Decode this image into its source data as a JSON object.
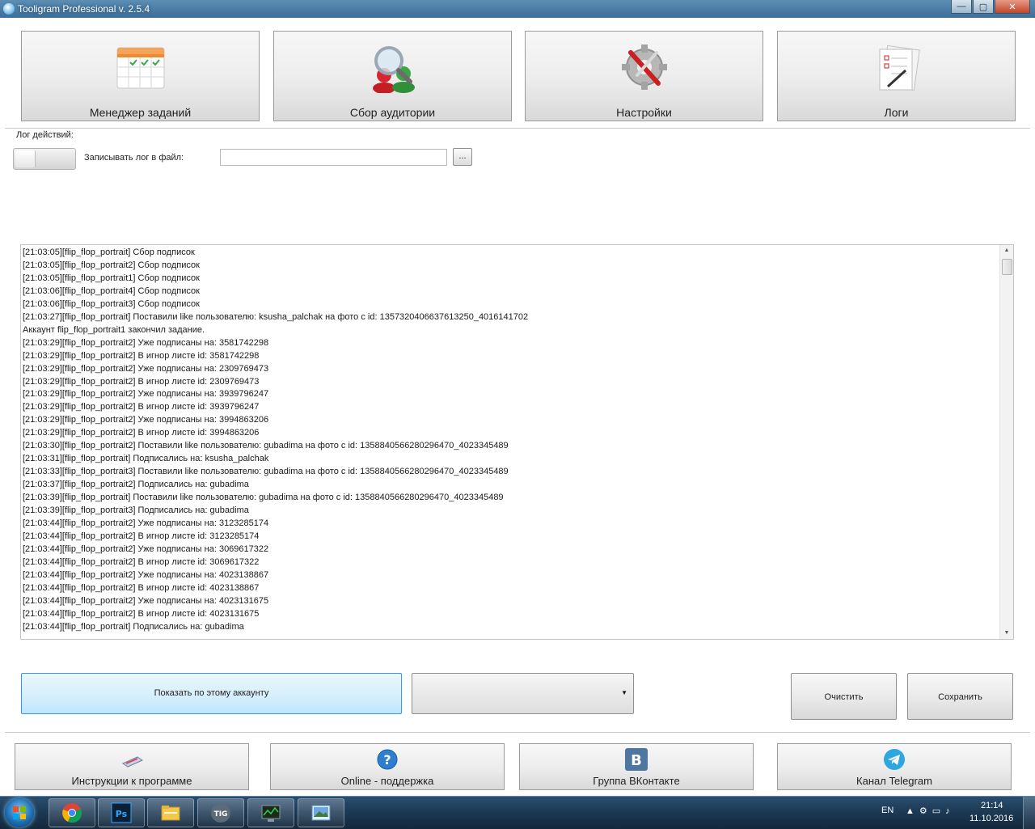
{
  "window": {
    "title": "Tooligram Professional v. 2.5.4",
    "buttons": {
      "minimize": "—",
      "maximize": "▢",
      "close": "✕"
    }
  },
  "top_nav": [
    {
      "label": "Менеджер заданий",
      "icon": "calendar-tasks-icon"
    },
    {
      "label": "Сбор аудитории",
      "icon": "audience-search-icon"
    },
    {
      "label": "Настройки",
      "icon": "settings-gear-icon"
    },
    {
      "label": "Логи",
      "icon": "log-pages-icon"
    }
  ],
  "log_panel": {
    "group_title": "Лог действий:",
    "write_to_file_label": "Записывать лог в файл:",
    "file_path_value": "",
    "browse_label": "...",
    "toggle_on": false,
    "lines": [
      "[21:03:05][flip_flop_portrait] Сбор подписок",
      "[21:03:05][flip_flop_portrait2] Сбор подписок",
      "[21:03:05][flip_flop_portrait1] Сбор подписок",
      "[21:03:06][flip_flop_portrait4] Сбор подписок",
      "[21:03:06][flip_flop_portrait3] Сбор подписок",
      "[21:03:27][flip_flop_portrait] Поставили like пользователю: ksusha_palchak на фото с id: 1357320406637613250_4016141702",
      "Аккаунт flip_flop_portrait1 закончил задание.",
      "[21:03:29][flip_flop_portrait2] Уже подписаны на: 3581742298",
      "[21:03:29][flip_flop_portrait2] В игнор листе id: 3581742298",
      "[21:03:29][flip_flop_portrait2] Уже подписаны на: 2309769473",
      "[21:03:29][flip_flop_portrait2] В игнор листе id: 2309769473",
      "[21:03:29][flip_flop_portrait2] Уже подписаны на: 3939796247",
      "[21:03:29][flip_flop_portrait2] В игнор листе id: 3939796247",
      "[21:03:29][flip_flop_portrait2] Уже подписаны на: 3994863206",
      "[21:03:29][flip_flop_portrait2] В игнор листе id: 3994863206",
      "[21:03:30][flip_flop_portrait2] Поставили like пользователю: gubadima на фото с id: 1358840566280296470_4023345489",
      "[21:03:31][flip_flop_portrait] Подписались на: ksusha_palchak",
      "[21:03:33][flip_flop_portrait3] Поставили like пользователю: gubadima на фото с id: 1358840566280296470_4023345489",
      "[21:03:37][flip_flop_portrait2] Подписались на: gubadima",
      "[21:03:39][flip_flop_portrait] Поставили like пользователю: gubadima на фото с id: 1358840566280296470_4023345489",
      "[21:03:39][flip_flop_portrait3] Подписались на: gubadima",
      "[21:03:44][flip_flop_portrait2] Уже подписаны на: 3123285174",
      "[21:03:44][flip_flop_portrait2] В игнор листе id: 3123285174",
      "[21:03:44][flip_flop_portrait2] Уже подписаны на: 3069617322",
      "[21:03:44][flip_flop_portrait2] В игнор листе id: 3069617322",
      "[21:03:44][flip_flop_portrait2] Уже подписаны на: 4023138867",
      "[21:03:44][flip_flop_portrait2] В игнор листе id: 4023138867",
      "[21:03:44][flip_flop_portrait2] Уже подписаны на: 4023131675",
      "[21:03:44][flip_flop_portrait2] В игнор листе id: 4023131675",
      "[21:03:44][flip_flop_portrait] Подписались на: gubadima"
    ]
  },
  "controls": {
    "show_by_account": "Показать по этому аккаунту",
    "account_select_value": "",
    "clear": "Очистить",
    "save": "Сохранить"
  },
  "footer": [
    {
      "label": "Инструкции к программе",
      "icon": "instructions-icon"
    },
    {
      "label": "Online - поддержка",
      "icon": "help-question-icon"
    },
    {
      "label": "Группа ВКонтакте",
      "icon": "vk-icon"
    },
    {
      "label": "Канал Telegram",
      "icon": "telegram-icon"
    }
  ],
  "taskbar": {
    "apps": [
      "chrome-icon",
      "photoshop-icon",
      "file-explorer-icon",
      "tooligram-icon",
      "task-manager-icon",
      "image-viewer-icon"
    ],
    "photoshop_text": "Ps",
    "tooligram_text": "TIG",
    "language": "EN",
    "time": "21:14",
    "date": "11.10.2016"
  },
  "colors": {
    "accent_blue": "#3c98d3",
    "title_bar": "#4a7ea6",
    "taskbar": "#1d3a55"
  }
}
